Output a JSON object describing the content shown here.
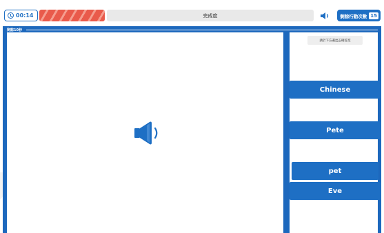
{
  "header": {
    "timer": "00:14",
    "progress_label": "完成度",
    "actions_label": "剩餘行動次數",
    "actions_count": "15"
  },
  "panel": {
    "label": "剩餘10秒"
  },
  "question": {
    "instruction": "請於下方選出正確答案",
    "audio_icon": "speaker-icon"
  },
  "options": [
    {
      "label": "Chinese"
    },
    {
      "label": "Pete"
    },
    {
      "label": "pet"
    },
    {
      "label": "Eve"
    }
  ],
  "colors": {
    "primary": "#1e6fc4",
    "frame": "#1d68bd",
    "timebar": "#e95a4b",
    "progress_bg": "#e9e9e9"
  }
}
